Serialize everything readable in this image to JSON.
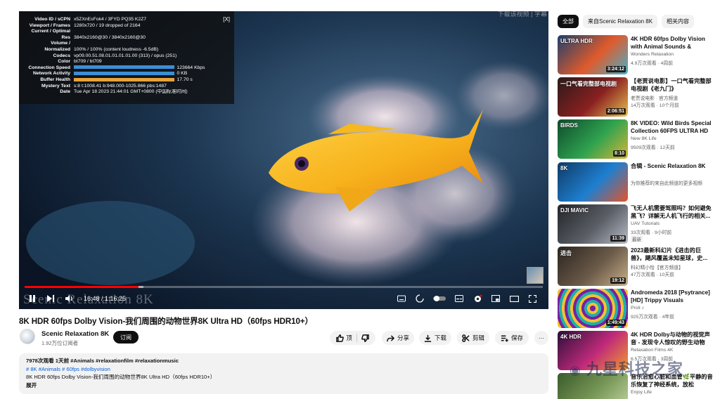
{
  "player": {
    "stats": [
      {
        "k": "Video ID / sCPN",
        "v": "x5ZXnEsFok4 / 3FYD PQ35 K2Z7"
      },
      {
        "k": "Viewport / Frames",
        "v": "1280x720 / 19 dropped of 2164"
      },
      {
        "k": "Current / Optimal",
        "v": ""
      },
      {
        "k": "Res",
        "v": "3840x2160@30 / 3840x2160@30"
      },
      {
        "k": "Volume /",
        "v": ""
      },
      {
        "k": "Normalized",
        "v": "100% / 100% (content loudness -6.5dB)"
      },
      {
        "k": "Codecs",
        "v": "vp09.00.51.08.01.01.01.01.00 (313) / opus (251)"
      },
      {
        "k": "Color",
        "v": "bt709 / bt709"
      },
      {
        "k": "Connection Speed",
        "v": "123664 Kbps",
        "bar": 0.95,
        "barColor": "#3b8fd6"
      },
      {
        "k": "Network Activity",
        "v": "0 KB",
        "bar": 0.95,
        "barColor": "#3b8fd6"
      },
      {
        "k": "Buffer Health",
        "v": "17.70 s",
        "bar": 0.95,
        "barColor": "#e8a33a"
      },
      {
        "k": "Mystery Text",
        "v": "s:8 t:1008.41 b:948.000-1025.866 pbs:1487"
      },
      {
        "k": "Date",
        "v": "Tue Apr 18 2023 21:44:01 GMT+0800 (中国标准时间)"
      }
    ],
    "stats_close": "[X]",
    "top_watermark": "下载该视频 | 字幕",
    "progress_played": 0.22,
    "progress_buffered": 0.23,
    "timecode": "16:48 / 1:16:25",
    "channel_watermark": "Scenic Relaxation 8K"
  },
  "video": {
    "title": "8K HDR 60fps Dolby Vision-我们周围的动物世界8K Ultra HD（60fps HDR10+）",
    "channel": "Scenic Relaxation 8K",
    "subscribers": "1.92万位订阅者",
    "subscribe_label": "订阅",
    "like_label": "顶",
    "share_label": "分享",
    "download_label": "下载",
    "clip_label": "剪辑",
    "save_label": "保存",
    "more_label": "···"
  },
  "description": {
    "meta": "7978次观看  1天前  #Animals #relaxationfilm #relaxationmusic",
    "tags": "# 8K #Animals # 60fps #dolbyvision",
    "text": "8K HDR 60fps Dolby Vision-我们周围的动物世界8K Ultra HD（60fps HDR10+）",
    "expand": "展开"
  },
  "chips": [
    "全部",
    "来自Scenic Relaxation 8K",
    "相关内容"
  ],
  "recommendations": [
    {
      "title": "4K HDR 60fps Dolby Vision with Animal Sounds & Calming...",
      "channel": "Wonders Relaxation",
      "meta": "4.9万次观看 · 4周前",
      "duration": "3:24:12",
      "badge": "",
      "thumb_text": "ULTRA HDR",
      "colors": [
        "#1d3f6e",
        "#e05a2b",
        "#48b0c9"
      ]
    },
    {
      "title": "【老贾说电影】一口气看完整部电视剧《老九门》",
      "channel": "老贾说电影 · 官方频道",
      "meta": "14万次观看 · 10个月前",
      "duration": "2:06:51",
      "badge": "",
      "thumb_text": "一口气看完整部电视剧",
      "colors": [
        "#2a1a1a",
        "#8a2020",
        "#e8c050"
      ]
    },
    {
      "title": "8K VIDEO: Wild Birds Special Collection 60FPS ULTRA HD I...",
      "channel": "New 8K Life",
      "meta": "9509次观看 · 12天前",
      "duration": "8:10",
      "badge": "",
      "thumb_text": "BIRDS",
      "colors": [
        "#0e4a2c",
        "#2fa34f",
        "#d6b53a"
      ]
    },
    {
      "title": "合辑 - Scenic Relaxation 8K",
      "channel": "为你推荐的来自此频道的更多视频",
      "meta": "",
      "duration": "",
      "badge": "",
      "thumb_text": "8K",
      "colors": [
        "#103a66",
        "#1e7fd0",
        "#e2542a"
      ]
    },
    {
      "title": "飞无人机需要驾照吗？如何避免黑飞？详解无人机飞行的相关...",
      "channel": "UAV Tutorials",
      "meta": "33次观看 · 9小时前",
      "duration": "11:39",
      "badge": "最新",
      "thumb_text": "DJI MAVIC",
      "colors": [
        "#222428",
        "#5a5e66",
        "#b8bcc4"
      ]
    },
    {
      "title": "2023最新科幻片《进击的巨兽》，飓风覆盖未知星球，史...",
      "channel": "科幻精小怡【官方频道】",
      "meta": "47万次观看 · 10天前",
      "duration": "19:12",
      "badge": "",
      "thumb_text": "进击",
      "colors": [
        "#2b2420",
        "#6a5a48",
        "#c9b08a"
      ]
    },
    {
      "title": "Andromeda 2018 [Psytrance] [HD] Trippy Visuals",
      "channel": "Proli ♪",
      "meta": "925万次观看 · 4年前",
      "duration": "1:49:43",
      "badge": "",
      "thumb_text": "",
      "colors": [
        "#7a1fa2",
        "#f5c030",
        "#1fb0a8"
      ]
    },
    {
      "title": "4K HDR Dolby与动物的视觉声音 - 发现令人惊叹的野生动物（五...",
      "channel": "Relaxation Films 4K",
      "meta": "6.5万次观看 · 3周前",
      "duration": "",
      "badge": "",
      "thumb_text": "4K HDR",
      "colors": [
        "#2a0f3a",
        "#c02a7a",
        "#f09a30"
      ]
    },
    {
      "title": "音乐治愈心脏和血管🌿平静的音乐恢复了神经系统，放松",
      "channel": "Enjoy Life",
      "meta": "",
      "duration": "",
      "badge": "",
      "thumb_text": "",
      "colors": [
        "#3a5a2a",
        "#7a9a5a",
        "#c8d8a8"
      ]
    }
  ],
  "site_watermark": "九星科技之家"
}
